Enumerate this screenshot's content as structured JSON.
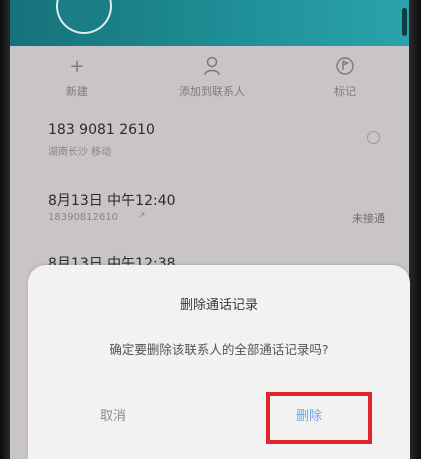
{
  "header": {
    "avatar_icon": "contact-avatar-icon"
  },
  "actions": [
    {
      "label": "新建",
      "icon": "plus-icon"
    },
    {
      "label": "添加到联系人",
      "icon": "person-icon"
    },
    {
      "label": "标记",
      "icon": "tag-icon"
    }
  ],
  "contact": {
    "number": "183 9081 2610",
    "location": "湖南长沙 移动"
  },
  "calls": [
    {
      "time": "8月13日 中午12:40",
      "number": "18390812610",
      "status": "未接通"
    },
    {
      "time": "8月13日 中午12:38"
    }
  ],
  "dialog": {
    "title": "删除通话记录",
    "message": "确定要删除该联系人的全部通话记录吗?",
    "cancel_label": "取消",
    "delete_label": "删除"
  },
  "colors": {
    "header": "#1f8e96",
    "delete_button": "#6aa7e6",
    "highlight_box": "#e0262d"
  }
}
